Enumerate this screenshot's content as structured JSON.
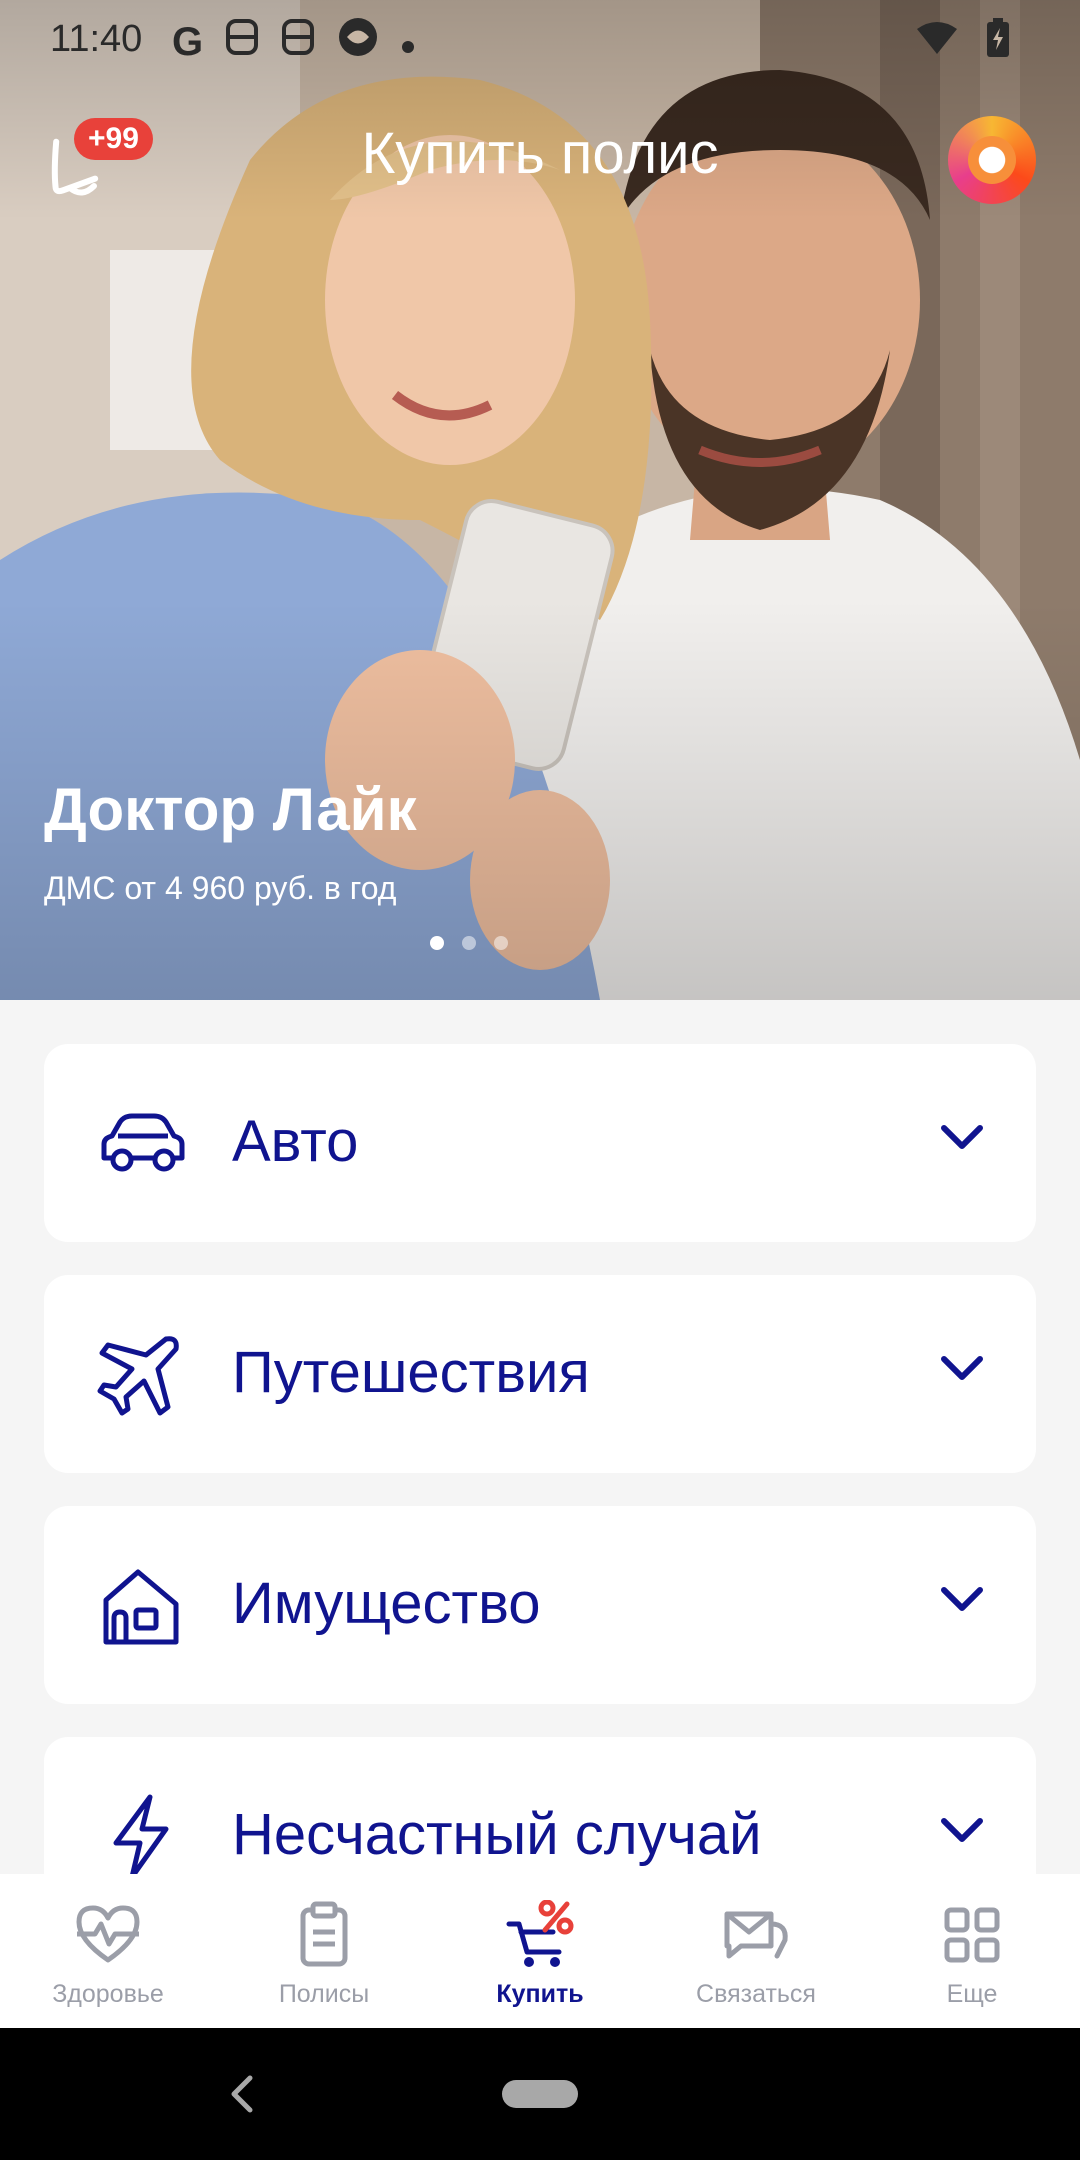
{
  "status_bar": {
    "time": "11:40",
    "left_icons": [
      "google-icon",
      "notification-icon",
      "notification-icon",
      "app-icon",
      "dot-icon"
    ],
    "right_icons": [
      "wifi-icon",
      "battery-icon"
    ]
  },
  "header": {
    "title": "Купить полис",
    "notification_badge": "+99"
  },
  "hero": {
    "title": "Доктор Лайк",
    "subtitle": "ДМС от 4 960 руб. в год",
    "slide_count": 3,
    "active_slide": 1
  },
  "categories": [
    {
      "label": "Авто",
      "icon": "car-icon"
    },
    {
      "label": "Путешествия",
      "icon": "airplane-icon"
    },
    {
      "label": "Имущество",
      "icon": "house-icon"
    },
    {
      "label": "Несчастный случай",
      "icon": "lightning-icon"
    }
  ],
  "bottom_nav": [
    {
      "label": "Здоровье",
      "icon": "heart-pulse-icon"
    },
    {
      "label": "Полисы",
      "icon": "clipboard-icon"
    },
    {
      "label": "Купить",
      "icon": "cart-percent-icon",
      "active": true
    },
    {
      "label": "Связаться",
      "icon": "chat-icon"
    },
    {
      "label": "Еще",
      "icon": "grid-icon"
    }
  ],
  "colors": {
    "brand_navy": "#10148f",
    "badge_red": "#e8413a",
    "nav_inactive": "#9b9ea8",
    "background": "#f5f5f5"
  }
}
